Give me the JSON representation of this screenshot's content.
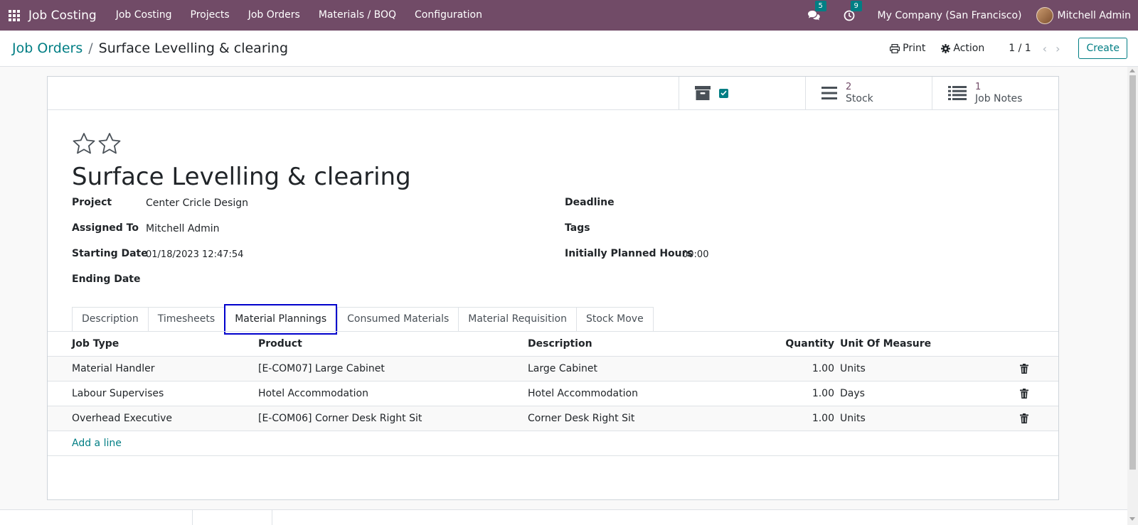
{
  "navbar": {
    "app_name": "Job Costing",
    "menu": [
      "Job Costing",
      "Projects",
      "Job Orders",
      "Materials / BOQ",
      "Configuration"
    ],
    "messages_count": "5",
    "activities_count": "9",
    "company": "My Company (San Francisco)",
    "user": "Mitchell Admin",
    "bg_color": "#714b67",
    "badge_color": "#017e84"
  },
  "control_panel": {
    "breadcrumb_parent": "Job Orders",
    "breadcrumb_current": "Surface Levelling & clearing",
    "print_label": "Print",
    "action_label": "Action",
    "pager": "1 / 1",
    "create_label": "Create"
  },
  "smart_buttons": {
    "stock_value": "2",
    "stock_label": "Stock",
    "notes_value": "1",
    "notes_label": "Job Notes"
  },
  "record": {
    "title": "Surface Levelling & clearing",
    "fields_left": [
      {
        "label": "Project",
        "value": "Center Cricle Design"
      },
      {
        "label": "Assigned To",
        "value": "Mitchell Admin"
      },
      {
        "label": "Starting Date",
        "value": "01/18/2023 12:47:54"
      },
      {
        "label": "Ending Date",
        "value": ""
      }
    ],
    "fields_right": [
      {
        "label": "Deadline",
        "value": ""
      },
      {
        "label": "Tags",
        "value": ""
      },
      {
        "label": "Initially Planned Hours",
        "value": "00:00"
      }
    ]
  },
  "tabs": [
    "Description",
    "Timesheets",
    "Material Plannings",
    "Consumed Materials",
    "Material Requisition",
    "Stock Move"
  ],
  "active_tab": "Material Plannings",
  "table": {
    "columns": [
      "Job Type",
      "Product",
      "Description",
      "Quantity",
      "Unit Of Measure"
    ],
    "rows": [
      {
        "job_type": "Material Handler",
        "product": "[E-COM07] Large Cabinet",
        "description": "Large Cabinet",
        "quantity": "1.00",
        "uom": "Units"
      },
      {
        "job_type": "Labour Supervises",
        "product": "Hotel Accommodation",
        "description": "Hotel Accommodation",
        "quantity": "1.00",
        "uom": "Days"
      },
      {
        "job_type": "Overhead Executive",
        "product": "[E-COM06] Corner Desk Right Sit",
        "description": "Corner Desk Right Sit",
        "quantity": "1.00",
        "uom": "Units"
      }
    ],
    "add_line": "Add a line"
  }
}
